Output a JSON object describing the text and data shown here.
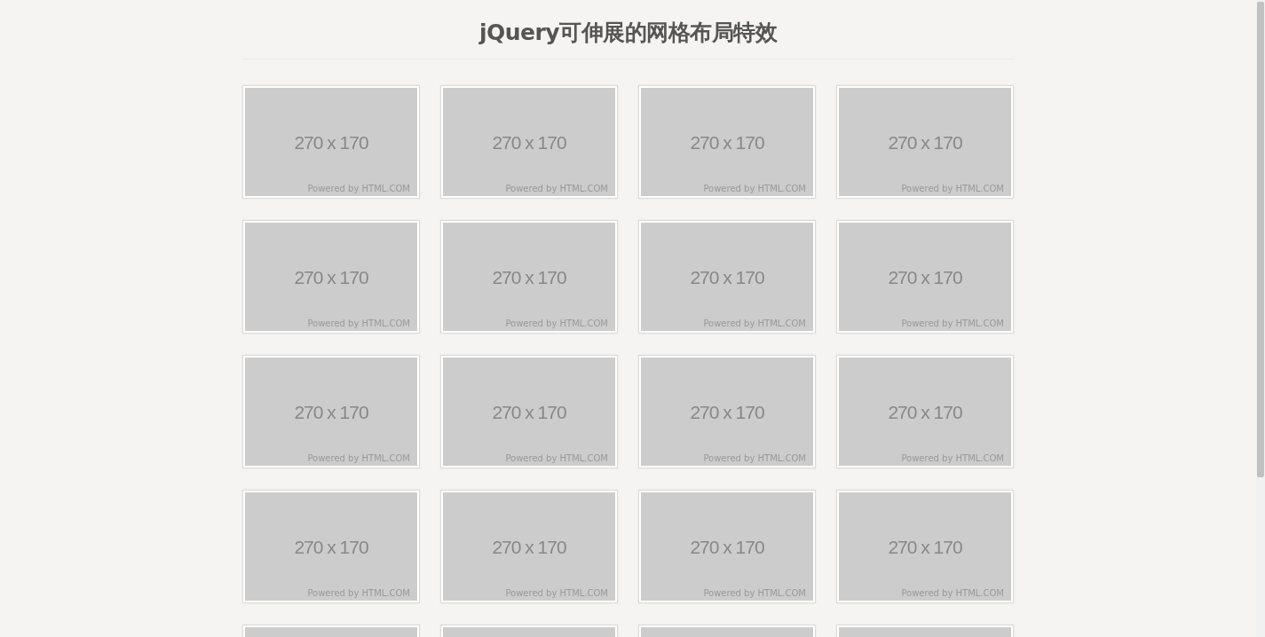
{
  "title": "jQuery可伸展的网格布局特效",
  "cards": [
    {
      "kind": "full",
      "size": "270 x 170",
      "credit": "Powered by HTML.COM"
    },
    {
      "kind": "full",
      "size": "270 x 170",
      "credit": "Powered by HTML.COM"
    },
    {
      "kind": "full",
      "size": "270 x 170",
      "credit": "Powered by HTML.COM"
    },
    {
      "kind": "full",
      "size": "270 x 170",
      "credit": "Powered by HTML.COM"
    },
    {
      "kind": "full",
      "size": "270 x 170",
      "credit": "Powered by HTML.COM"
    },
    {
      "kind": "full",
      "size": "270 x 170",
      "credit": "Powered by HTML.COM"
    },
    {
      "kind": "full",
      "size": "270 x 170",
      "credit": "Powered by HTML.COM"
    },
    {
      "kind": "full",
      "size": "270 x 170",
      "credit": "Powered by HTML.COM"
    },
    {
      "kind": "full",
      "size": "270 x 170",
      "credit": "Powered by HTML.COM"
    },
    {
      "kind": "full",
      "size": "270 x 170",
      "credit": "Powered by HTML.COM"
    },
    {
      "kind": "full",
      "size": "270 x 170",
      "credit": "Powered by HTML.COM"
    },
    {
      "kind": "full",
      "size": "270 x 170",
      "credit": "Powered by HTML.COM"
    },
    {
      "kind": "full",
      "size": "270 x 170",
      "credit": "Powered by HTML.COM"
    },
    {
      "kind": "full",
      "size": "270 x 170",
      "credit": "Powered by HTML.COM"
    },
    {
      "kind": "full",
      "size": "270 x 170",
      "credit": "Powered by HTML.COM"
    },
    {
      "kind": "full",
      "size": "270 x 170",
      "credit": "Powered by HTML.COM"
    },
    {
      "kind": "cut"
    },
    {
      "kind": "cut"
    },
    {
      "kind": "cut"
    },
    {
      "kind": "cut"
    }
  ]
}
